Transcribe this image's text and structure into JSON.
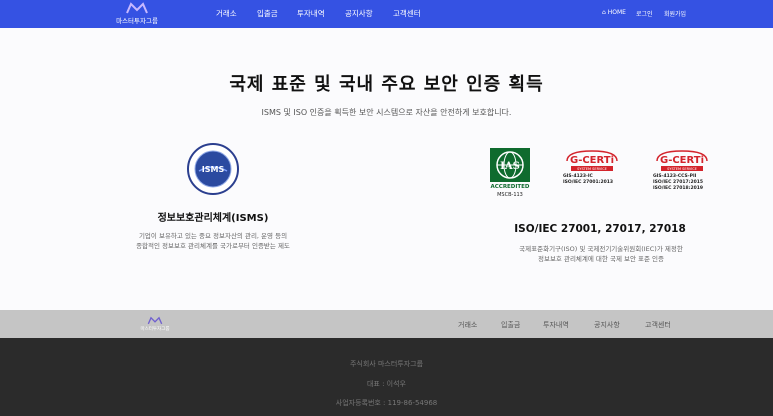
{
  "header": {
    "logo_text": "마스터투자그룹",
    "nav": [
      "거래소",
      "입출금",
      "투자내역",
      "공지사항",
      "고객센터"
    ],
    "home": "HOME",
    "login": "로그인",
    "signup": "회원가입"
  },
  "section": {
    "title": "국제 표준 및 국내 주요 보안 인증 획득",
    "subtitle": "ISMS 및 ISO 인증을 획득한 보안 시스템으로 자산을 안전하게 보호합니다."
  },
  "isms": {
    "badge_text": "ISMS",
    "title": "정보보호관리체계(ISMS)",
    "desc_line1": "기업이 보유하고 있는 중요 정보자산의 관리, 운영 등의",
    "desc_line2": "종합적인 정보보호 관리체계를 국가로부터 인증받는 제도"
  },
  "iso": {
    "ias_accredited": "ACCREDITED",
    "ias_code": "MSCB-113",
    "gcert1_lines": [
      "GIS-4123-IC",
      "ISO/IEC 27001:2013"
    ],
    "gcert2_lines": [
      "GIS-4123-CCS-PII",
      "ISO/IEC 27017:2015",
      "ISO/IEC 27018:2019"
    ],
    "gcert_label": "G-CERTi",
    "gcert_sub": "SYSTEM SERVICE",
    "title": "ISO/IEC 27001, 27017, 27018",
    "desc_line1": "국제표준화기구(ISO) 및 국제전기기술위원회(IEC)가 제정한",
    "desc_line2": "정보보호 관리체계에 대한 국제 보안 표준 인증"
  },
  "footer_nav": {
    "logo_text": "마스터투자그룹",
    "links": [
      "거래소",
      "입출금",
      "투자내역",
      "공지사항",
      "고객센터"
    ]
  },
  "footer": {
    "company": "주식회사 마스터투자그룹",
    "ceo": "대표 : 이석우",
    "biz_no": "사업자등록번호 : 119-86-54968"
  },
  "colors": {
    "header_bg": "#3552e3",
    "footer_nav_bg": "#c5c5c5",
    "footer_bg": "#2b2b2b",
    "gcert_red": "#d3232b"
  }
}
